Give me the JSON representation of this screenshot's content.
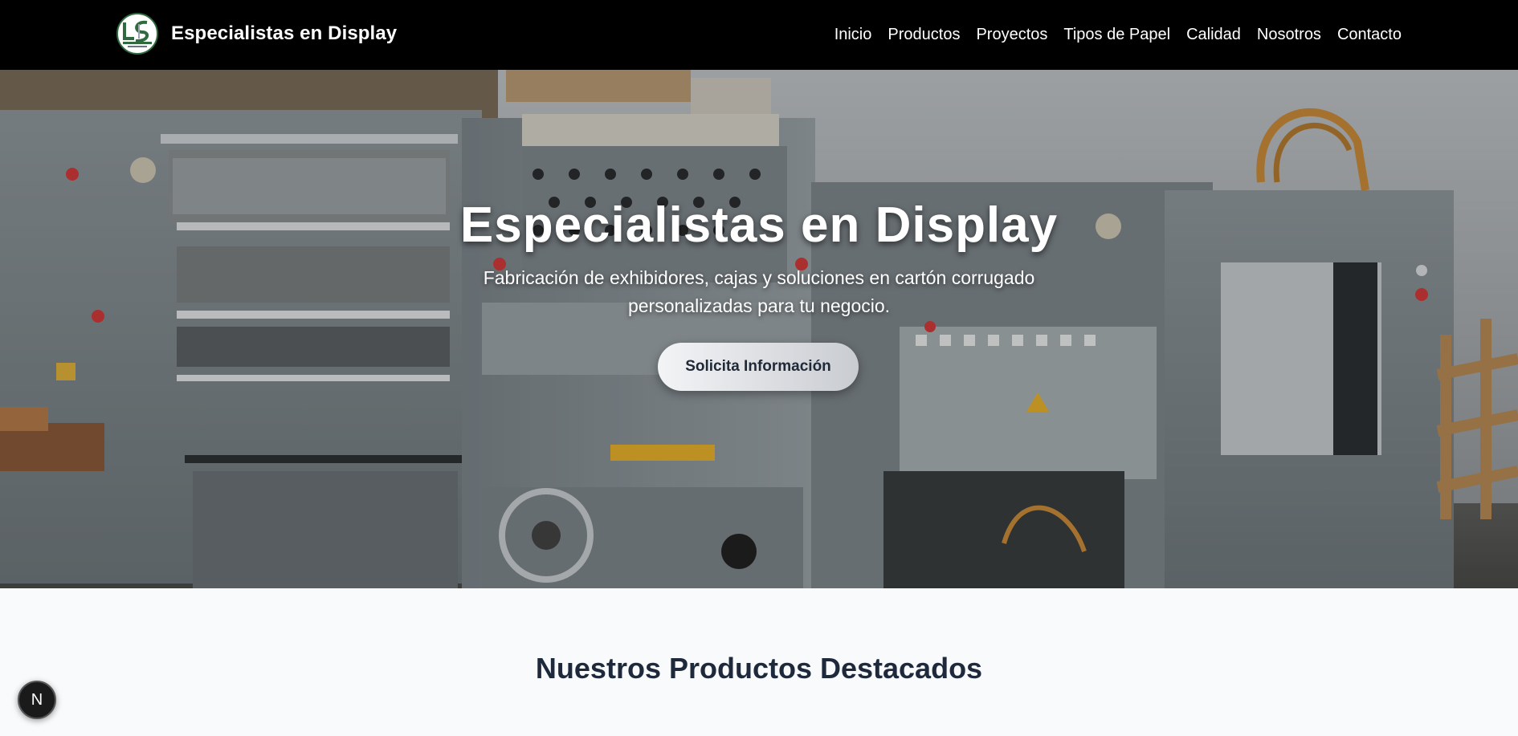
{
  "brand": {
    "name": "Especialistas en Display",
    "logo_icon": "lsd-logo-icon",
    "logo_text": "LSD"
  },
  "nav": {
    "items": [
      {
        "label": "Inicio"
      },
      {
        "label": "Productos"
      },
      {
        "label": "Proyectos"
      },
      {
        "label": "Tipos de Papel"
      },
      {
        "label": "Calidad"
      },
      {
        "label": "Nosotros"
      },
      {
        "label": "Contacto"
      }
    ]
  },
  "hero": {
    "title": "Especialistas en Display",
    "subtitle": "Fabricación de exhibidores, cajas y soluciones en cartón corrugado personalizadas para tu negocio.",
    "cta_label": "Solicita Información",
    "background": "industrial-die-cutting-machine-photo"
  },
  "products": {
    "title": "Nuestros Productos Destacados"
  },
  "fab": {
    "label": "N",
    "icon": "nextjs-dev-indicator-icon"
  },
  "colors": {
    "header_bg": "#000000",
    "page_bg": "#f8fafc",
    "heading": "#1e293b",
    "logo_green": "#2f6b3e"
  }
}
